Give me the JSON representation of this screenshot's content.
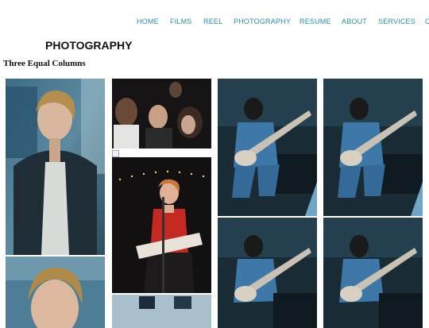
{
  "nav": {
    "items": [
      {
        "label": "HOME"
      },
      {
        "label": "FILMS"
      },
      {
        "label": "REEL"
      },
      {
        "label": "PHOTOGRAPHY"
      },
      {
        "label": "RESUME"
      },
      {
        "label": "ABOUT"
      },
      {
        "label": "SERVICES"
      },
      {
        "label": "C"
      }
    ],
    "color": "#2a8fb8"
  },
  "page": {
    "title": "PHOTOGRAPHY",
    "subtitle": "Three Equal Columns"
  },
  "colors": {
    "background": "#ffffff",
    "heading": "#111111"
  },
  "gallery": {
    "icons": [
      "portrait-photo",
      "crowd-photo",
      "broken-image-icon",
      "singer-photo",
      "window-photo",
      "guitarist-photo"
    ]
  }
}
